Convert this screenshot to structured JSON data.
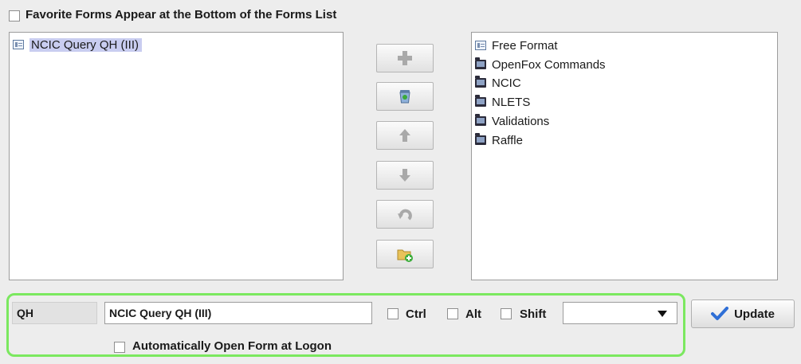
{
  "favorites_option": {
    "label": "Favorite Forms Appear at the Bottom of the Forms List",
    "checked": false
  },
  "favorites_list": {
    "items": [
      {
        "label": "NCIC Query QH (III)",
        "icon": "form-icon",
        "selected": true
      }
    ]
  },
  "forms_tree": {
    "items": [
      {
        "label": "Free Format",
        "icon": "form-icon"
      },
      {
        "label": "OpenFox Commands",
        "icon": "folder-icon"
      },
      {
        "label": "NCIC",
        "icon": "folder-icon"
      },
      {
        "label": "NLETS",
        "icon": "folder-icon"
      },
      {
        "label": "Validations",
        "icon": "folder-icon"
      },
      {
        "label": "Raffle",
        "icon": "folder-icon"
      }
    ]
  },
  "actions": {
    "add": "plus-icon",
    "remove": "recycle-bin-icon",
    "move_up": "arrow-up-icon",
    "move_down": "arrow-down-icon",
    "undo": "undo-icon",
    "new_folder": "new-folder-icon"
  },
  "editor": {
    "code_value": "QH",
    "name_value": "NCIC Query QH (III)",
    "ctrl_label": "Ctrl",
    "alt_label": "Alt",
    "shift_label": "Shift",
    "key_select_value": "",
    "update_label": "Update",
    "auto_open_label": "Automatically Open Form at Logon"
  },
  "colors": {
    "highlight_border": "#7be85f",
    "selection": "#c9cdf0",
    "update_check": "#2f6fd6"
  }
}
